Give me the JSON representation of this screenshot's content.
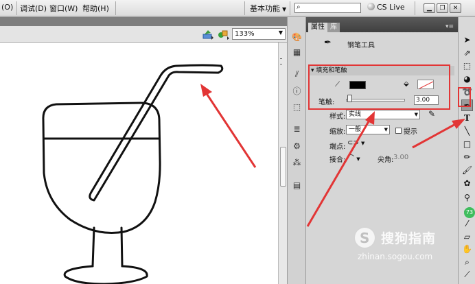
{
  "menu": {
    "items": [
      "(O)",
      "调试(D)",
      "窗口(W)",
      "帮助(H)"
    ],
    "workspace_label": "基本功能",
    "search_icon": "search-icon",
    "cslive_label": "CS Live",
    "window_buttons": [
      "minimize-icon",
      "restore-icon",
      "close-icon"
    ]
  },
  "edit_bar": {
    "zoom": "133%",
    "icons": [
      "edit-scene-icon",
      "edit-symbols-icon"
    ]
  },
  "properties": {
    "tabs": [
      "属性",
      "库"
    ],
    "tool_name": "钢笔工具",
    "section_title": "填充和笔触",
    "stroke_label": "笔触:",
    "stroke_value": "3.00",
    "stroke_fraction": 0.03,
    "style_label": "样式:",
    "style_value": "实线",
    "scale_label": "缩放:",
    "scale_value": "一般",
    "hint_label": "提示",
    "cap_label": "端点:",
    "join_label": "接合:",
    "miter_label": "尖角:",
    "miter_value": "3.00",
    "stroke_color": "#000000",
    "fill_color": "none"
  },
  "tools": {
    "active": "pen-tool",
    "badge": "73"
  },
  "canvas": {
    "background": "#ffffff",
    "drawing": "glass-with-straw",
    "annotation_color": "#e23535"
  },
  "watermark": {
    "text": "搜狗指南",
    "url": "zhinan.sogou.com"
  }
}
